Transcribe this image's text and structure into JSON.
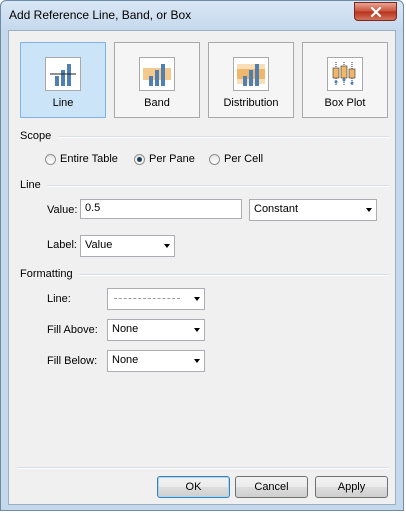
{
  "window": {
    "title": "Add Reference Line, Band, or Box"
  },
  "types": [
    {
      "label": "Line",
      "icon": "reference-line-icon",
      "selected": true
    },
    {
      "label": "Band",
      "icon": "reference-band-icon",
      "selected": false
    },
    {
      "label": "Distribution",
      "icon": "distribution-icon",
      "selected": false
    },
    {
      "label": "Box Plot",
      "icon": "box-plot-icon",
      "selected": false
    }
  ],
  "scope": {
    "title": "Scope",
    "options": [
      {
        "label": "Entire Table",
        "selected": false
      },
      {
        "label": "Per Pane",
        "selected": true
      },
      {
        "label": "Per Cell",
        "selected": false
      }
    ]
  },
  "line": {
    "title": "Line",
    "value_label": "Value:",
    "value": "0.5",
    "value_type": "Constant",
    "label_label": "Label:",
    "label_value": "Value"
  },
  "formatting": {
    "title": "Formatting",
    "line_label": "Line:",
    "fill_above_label": "Fill Above:",
    "fill_above": "None",
    "fill_below_label": "Fill Below:",
    "fill_below": "None"
  },
  "buttons": {
    "ok": "OK",
    "cancel": "Cancel",
    "apply": "Apply"
  },
  "colors": {
    "selected_bg": "#cce4f7",
    "close_red": "#c9503a",
    "bar_blue": "#4f7fb3",
    "band_orange": "#f5c98b"
  }
}
